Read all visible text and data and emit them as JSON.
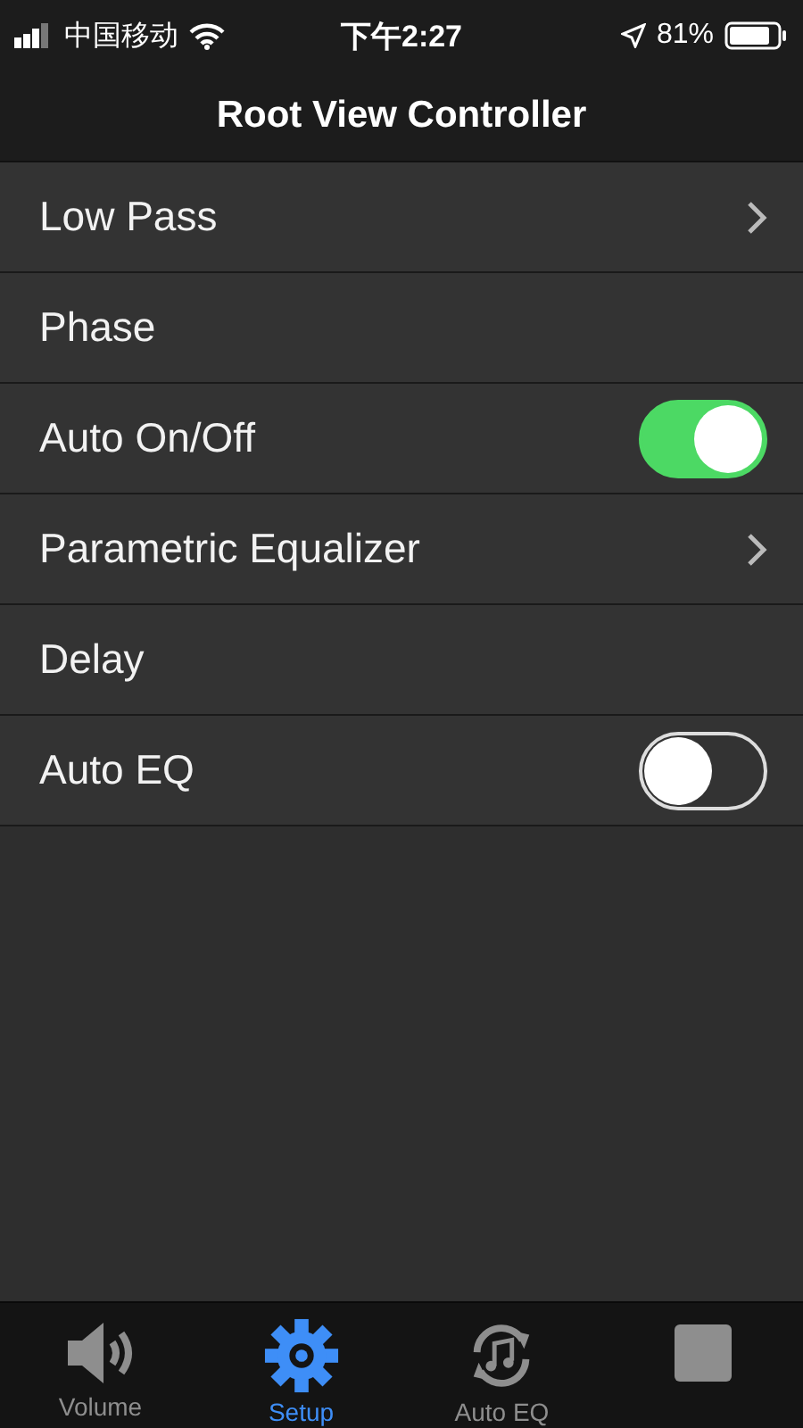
{
  "status_bar": {
    "carrier": "中国移动",
    "time": "下午2:27",
    "battery": "81%"
  },
  "nav": {
    "title": "Root View Controller"
  },
  "rows": [
    {
      "label": "Low Pass",
      "kind": "disclosure"
    },
    {
      "label": "Phase",
      "kind": "plain"
    },
    {
      "label": "Auto On/Off",
      "kind": "switch",
      "on": true
    },
    {
      "label": "Parametric Equalizer",
      "kind": "disclosure"
    },
    {
      "label": "Delay",
      "kind": "plain"
    },
    {
      "label": "Auto EQ",
      "kind": "switch",
      "on": false
    }
  ],
  "tabs": [
    {
      "label": "Volume",
      "kind": "speaker",
      "selected": false
    },
    {
      "label": "Setup",
      "kind": "gear",
      "selected": true
    },
    {
      "label": "Auto EQ",
      "kind": "refresh",
      "selected": false
    },
    {
      "kind": "panel",
      "selected": false
    }
  ]
}
